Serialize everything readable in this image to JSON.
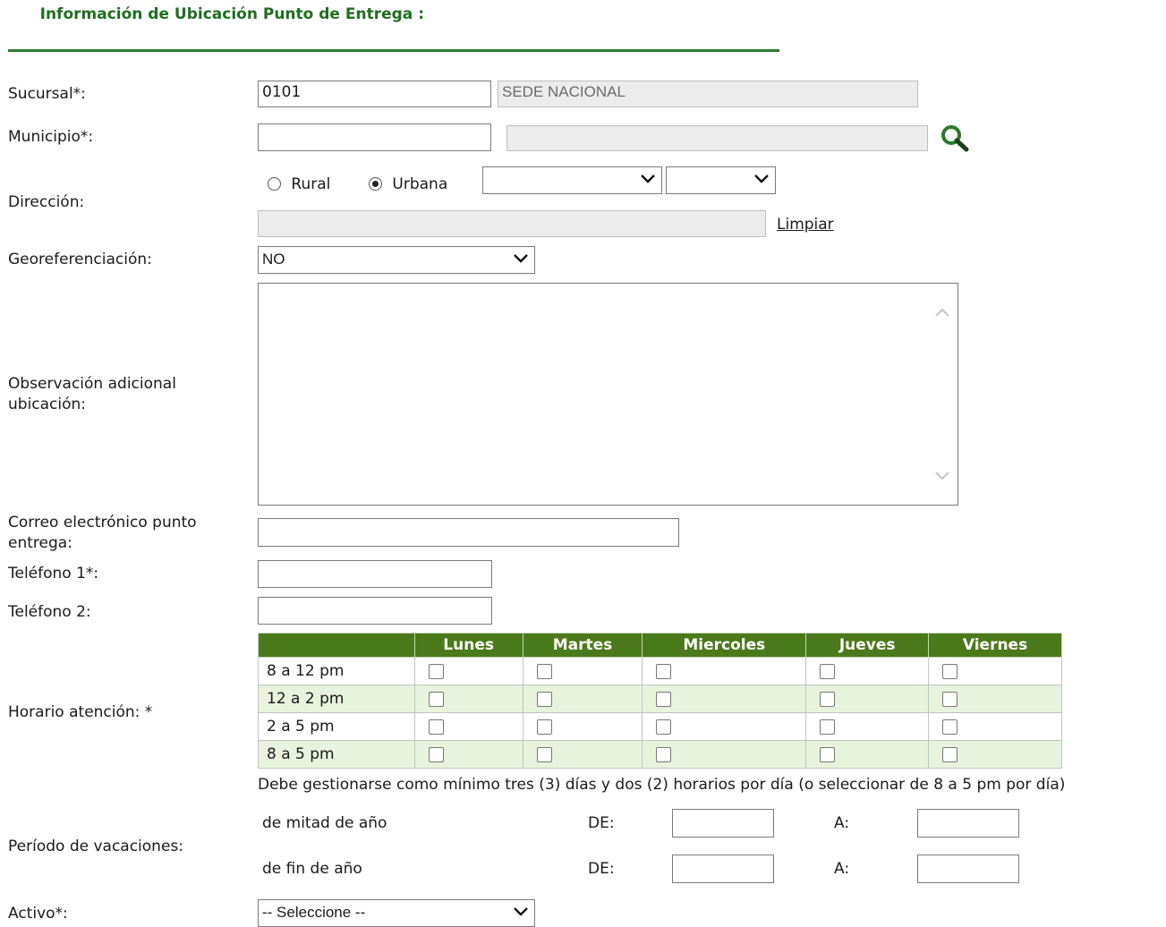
{
  "header": {
    "title": "Información de Ubicación Punto de Entrega :"
  },
  "sucursal": {
    "label": "Sucursal*:",
    "code": "0101",
    "name": "SEDE NACIONAL"
  },
  "municipio": {
    "label": "Municipio*:",
    "code": "",
    "name": "",
    "search_icon": "search-icon"
  },
  "direccion": {
    "label": "Dirección:",
    "rural_label": "Rural",
    "urbana_label": "Urbana",
    "selected": "Urbana",
    "select1_value": "",
    "select2_value": "",
    "address_value": "",
    "clear_link": "Limpiar"
  },
  "georef": {
    "label": "Georeferenciación:",
    "value": "NO"
  },
  "observacion": {
    "label_line1": "Observación adicional",
    "label_line2": "ubicación:",
    "value": ""
  },
  "correo": {
    "label_line1": "Correo electrónico punto",
    "label_line2": "entrega:",
    "value": ""
  },
  "telefono1": {
    "label": "Teléfono 1*:",
    "value": ""
  },
  "telefono2": {
    "label": "Teléfono 2:",
    "value": ""
  },
  "horario": {
    "label": "Horario atención: *",
    "days": [
      "Lunes",
      "Martes",
      "Miercoles",
      "Jueves",
      "Viernes"
    ],
    "slots": [
      "8 a 12 pm",
      "12 a 2 pm",
      "2 a 5 pm",
      "8 a 5 pm"
    ],
    "note": "Debe gestionarse como mínimo tres (3) días y dos (2) horarios por día (o seleccionar de 8 a 5 pm por día)"
  },
  "vacaciones": {
    "label": "Período de vacaciones:",
    "rows": [
      {
        "label": "de mitad de año",
        "de_label": "DE:",
        "a_label": "A:",
        "de_value": "",
        "a_value": ""
      },
      {
        "label": "de fin de año",
        "de_label": "DE:",
        "a_label": "A:",
        "de_value": "",
        "a_value": ""
      }
    ]
  },
  "activo": {
    "label": "Activo*:",
    "value": "-- Seleccione --"
  },
  "colors": {
    "title": "#1f6e1f",
    "table_header": "#4a7a1b",
    "alt_row": "#e8f3dd",
    "readonly": "#ececec"
  }
}
